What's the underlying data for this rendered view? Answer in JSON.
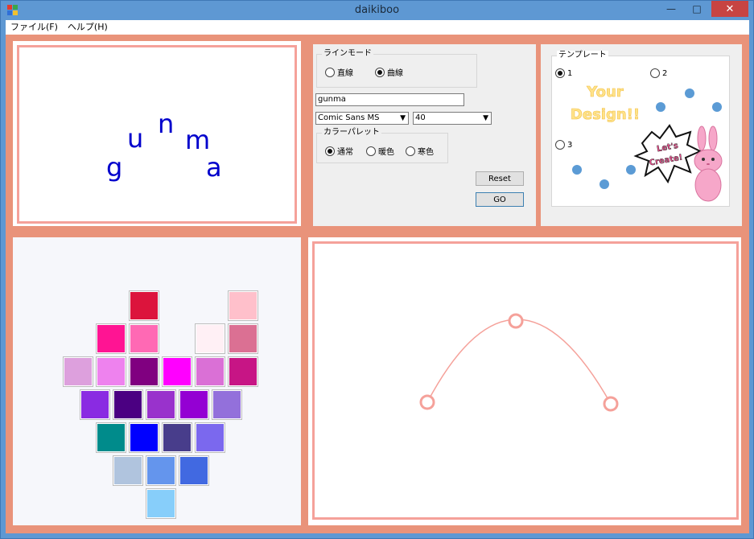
{
  "window": {
    "title": "daikiboo"
  },
  "menu": [
    {
      "label": "ファイル(F)"
    },
    {
      "label": "ヘルプ(H)"
    }
  ],
  "preview": {
    "text": "gunma",
    "text_color": "#0000cc"
  },
  "controls": {
    "line_mode": {
      "caption": "ラインモード",
      "options": [
        {
          "label": "直線",
          "selected": false
        },
        {
          "label": "曲線",
          "selected": true
        }
      ]
    },
    "text_input": {
      "value": "gunma"
    },
    "font_combo": {
      "value": "Comic Sans MS"
    },
    "size_combo": {
      "value": "40"
    },
    "palette_mode": {
      "caption": "カラーパレット",
      "options": [
        {
          "label": "通常",
          "selected": true
        },
        {
          "label": "暖色",
          "selected": false
        },
        {
          "label": "寒色",
          "selected": false
        }
      ]
    },
    "reset_label": "Reset",
    "go_label": "GO"
  },
  "templates": {
    "caption": "テンプレート",
    "options": [
      {
        "label": "1",
        "selected": true
      },
      {
        "label": "2",
        "selected": false
      },
      {
        "label": "3",
        "selected": false
      }
    ],
    "design_line1": "Your",
    "design_line2": "Design!!",
    "sticker_line1": "Let's",
    "sticker_line2": "Create!",
    "dot_color": "#5b9bd5"
  },
  "palette": {
    "colors": [
      "#dc143c",
      "#ffc0cb",
      "#ff1493",
      "#ff69b4",
      "#fff0f5",
      "#db7093",
      "#dda0dd",
      "#ee82ee",
      "#800080",
      "#ff00ff",
      "#da70d6",
      "#c71585",
      "#8a2be2",
      "#4b0082",
      "#9932cc",
      "#9400d3",
      "#9370db",
      "#008b8b",
      "#0000ff",
      "#483d8b",
      "#7b68ee",
      "#b0c4de",
      "#6495ed",
      "#4169e1",
      "#87cefa"
    ]
  },
  "curve": {
    "color": "#f5a19a"
  }
}
